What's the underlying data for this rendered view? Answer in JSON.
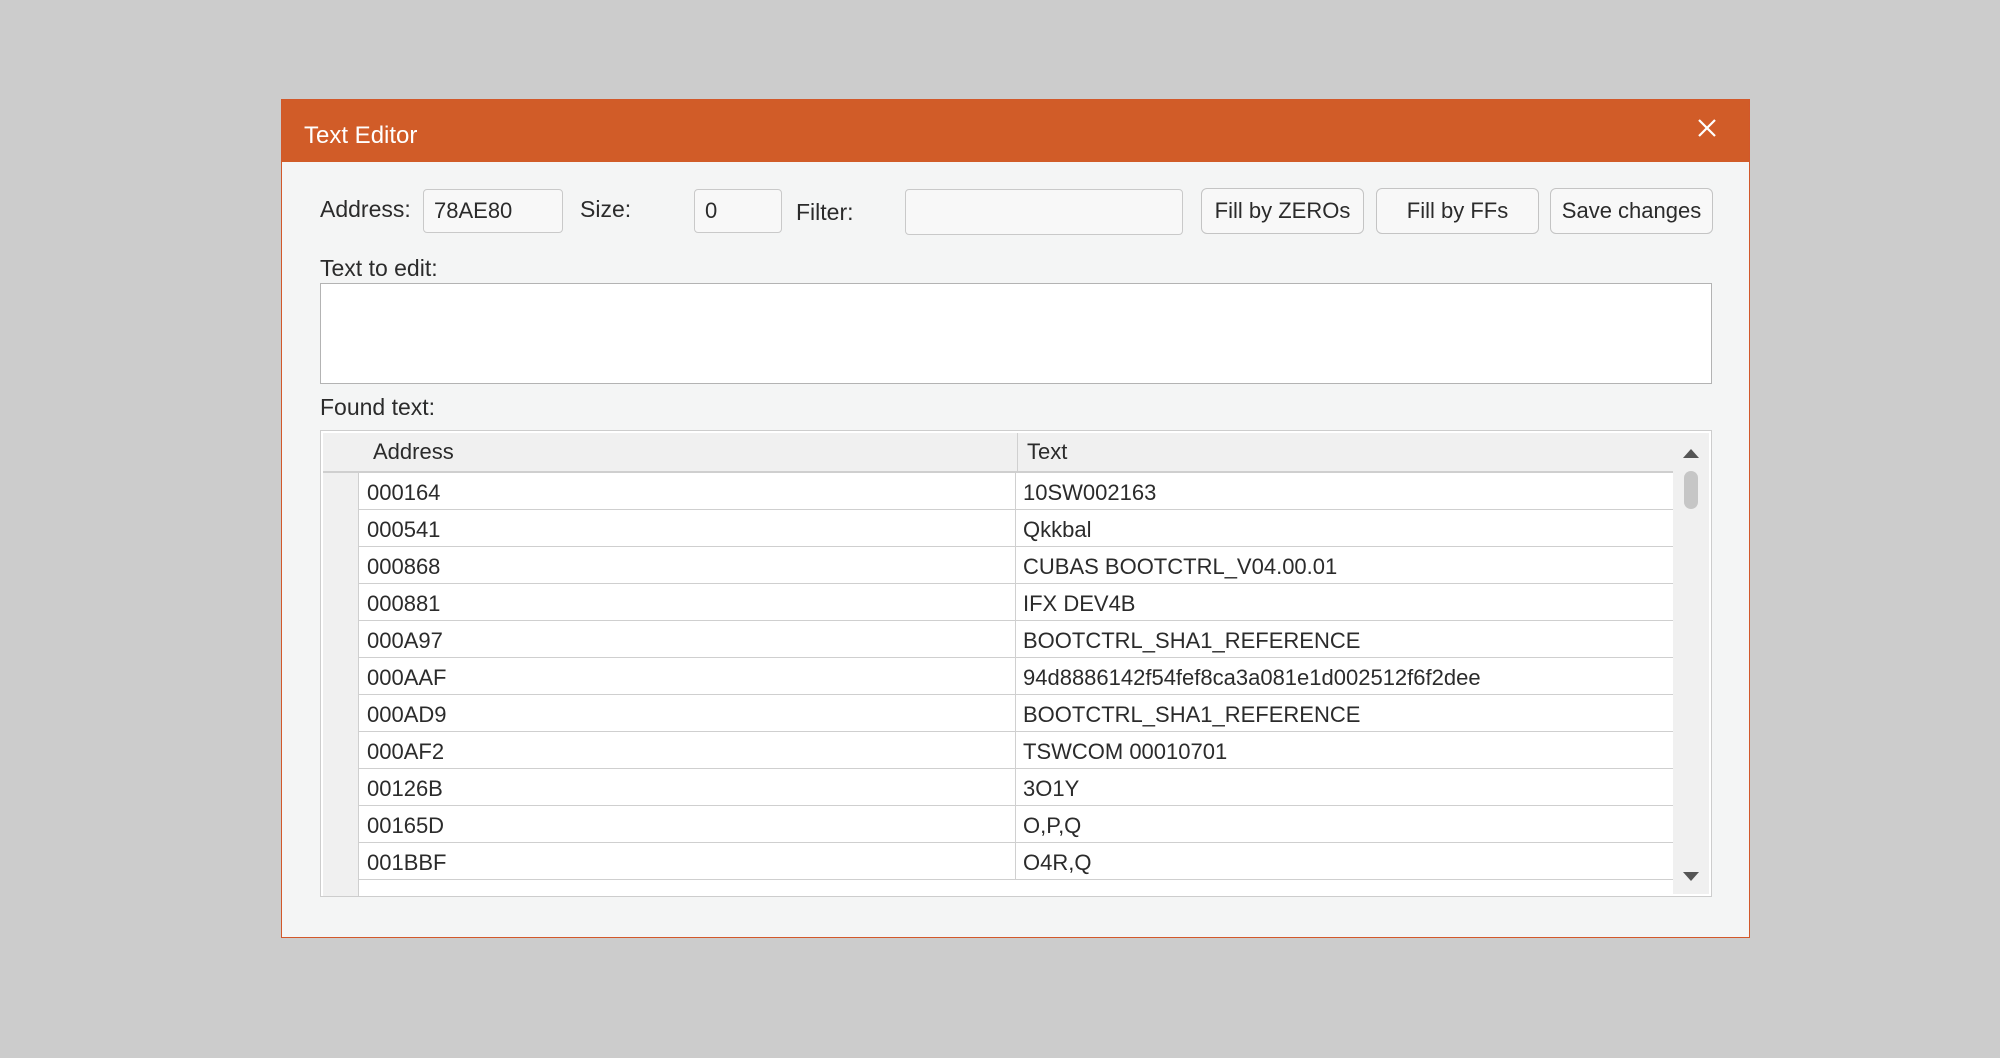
{
  "window": {
    "title": "Text Editor"
  },
  "toolbar": {
    "address_label": "Address:",
    "address_value": "78AE80",
    "size_label": "Size:",
    "size_value": "0",
    "filter_label": "Filter:",
    "filter_value": "",
    "fill_zeros_label": "Fill by ZEROs",
    "fill_ffs_label": "Fill by FFs",
    "save_label": "Save changes"
  },
  "editor": {
    "text_to_edit_label": "Text to edit:",
    "text_value": ""
  },
  "found": {
    "label": "Found text:",
    "columns": [
      "Address",
      "Text"
    ],
    "rows": [
      {
        "address": "000164",
        "text": "10SW002163"
      },
      {
        "address": "000541",
        "text": "Qkkbal"
      },
      {
        "address": "000868",
        "text": "CUBAS BOOTCTRL_V04.00.01"
      },
      {
        "address": "000881",
        "text": "IFX DEV4B"
      },
      {
        "address": "000A97",
        "text": "BOOTCTRL_SHA1_REFERENCE"
      },
      {
        "address": "000AAF",
        "text": "94d8886142f54fef8ca3a081e1d002512f6f2dee"
      },
      {
        "address": "000AD9",
        "text": "BOOTCTRL_SHA1_REFERENCE"
      },
      {
        "address": "000AF2",
        "text": "TSWCOM 00010701"
      },
      {
        "address": "00126B",
        "text": "3O1Y"
      },
      {
        "address": "00165D",
        "text": "O,P,Q"
      },
      {
        "address": "001BBF",
        "text": "O4R,Q"
      }
    ]
  },
  "colors": {
    "titlebar": "#d15c28",
    "background": "#cccccc"
  },
  "icons": {
    "close": "close-icon",
    "scroll_up": "scroll-up-arrow-icon",
    "scroll_down": "scroll-down-arrow-icon"
  }
}
